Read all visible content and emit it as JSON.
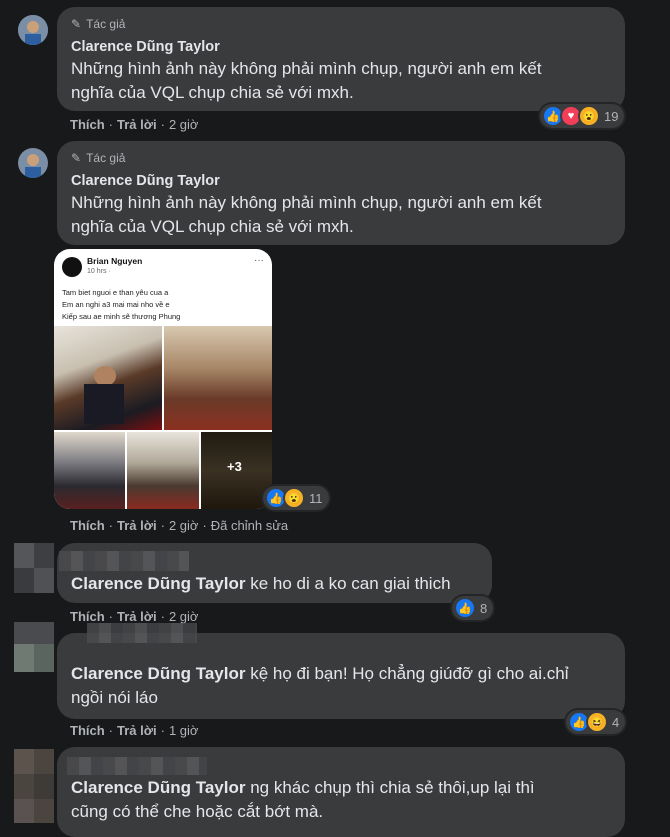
{
  "author_role": "Tác giả",
  "like_label": "Thích",
  "reply_label": "Trả lời",
  "comments": [
    {
      "name": "Clarence Dũng Taylor",
      "text_line1": "Những hình ảnh này không phải mình chụp, người anh em kết",
      "text_line2": "nghĩa của VQL chụp chia sẻ với mxh.",
      "time": "2 giờ",
      "reaction_count": "19"
    },
    {
      "name": "Clarence Dũng Taylor",
      "text_line1": "Những hình ảnh này không phải mình chụp, người anh em kết",
      "text_line2": "nghĩa của VQL chụp chia sẻ với mxh.",
      "time": "2 giờ",
      "edited": "Đã chỉnh sửa",
      "reaction_count": "11",
      "attachment": {
        "poster": "Brian Nguyen",
        "meta": "10 hrs ·",
        "line1": "Tam biet nguoi e than yêu  cua a",
        "line2": "Em an nghi a3 mai mai nho về e",
        "line3": "Kiếp sau ae minh sẽ thương Phung",
        "more_photos": "+3"
      }
    },
    {
      "name": "Clarence Dũng Taylor",
      "text": "ke ho di a ko can giai thich",
      "time": "2 giờ",
      "reaction_count": "8"
    },
    {
      "name": "Clarence Dũng Taylor",
      "text_line1": "kệ họ đi bạn! Họ chẳng giúđỡ gì cho ai.chỉ",
      "text_line2": "ngồi nói láo",
      "time": "1 giờ",
      "reaction_count": "4"
    },
    {
      "name": "Clarence Dũng Taylor",
      "text_line1": "ng khác chụp thì chia sẻ thôi,up lại thì",
      "text_line2": "cũng có thể che hoặc cắt bớt mà."
    }
  ]
}
